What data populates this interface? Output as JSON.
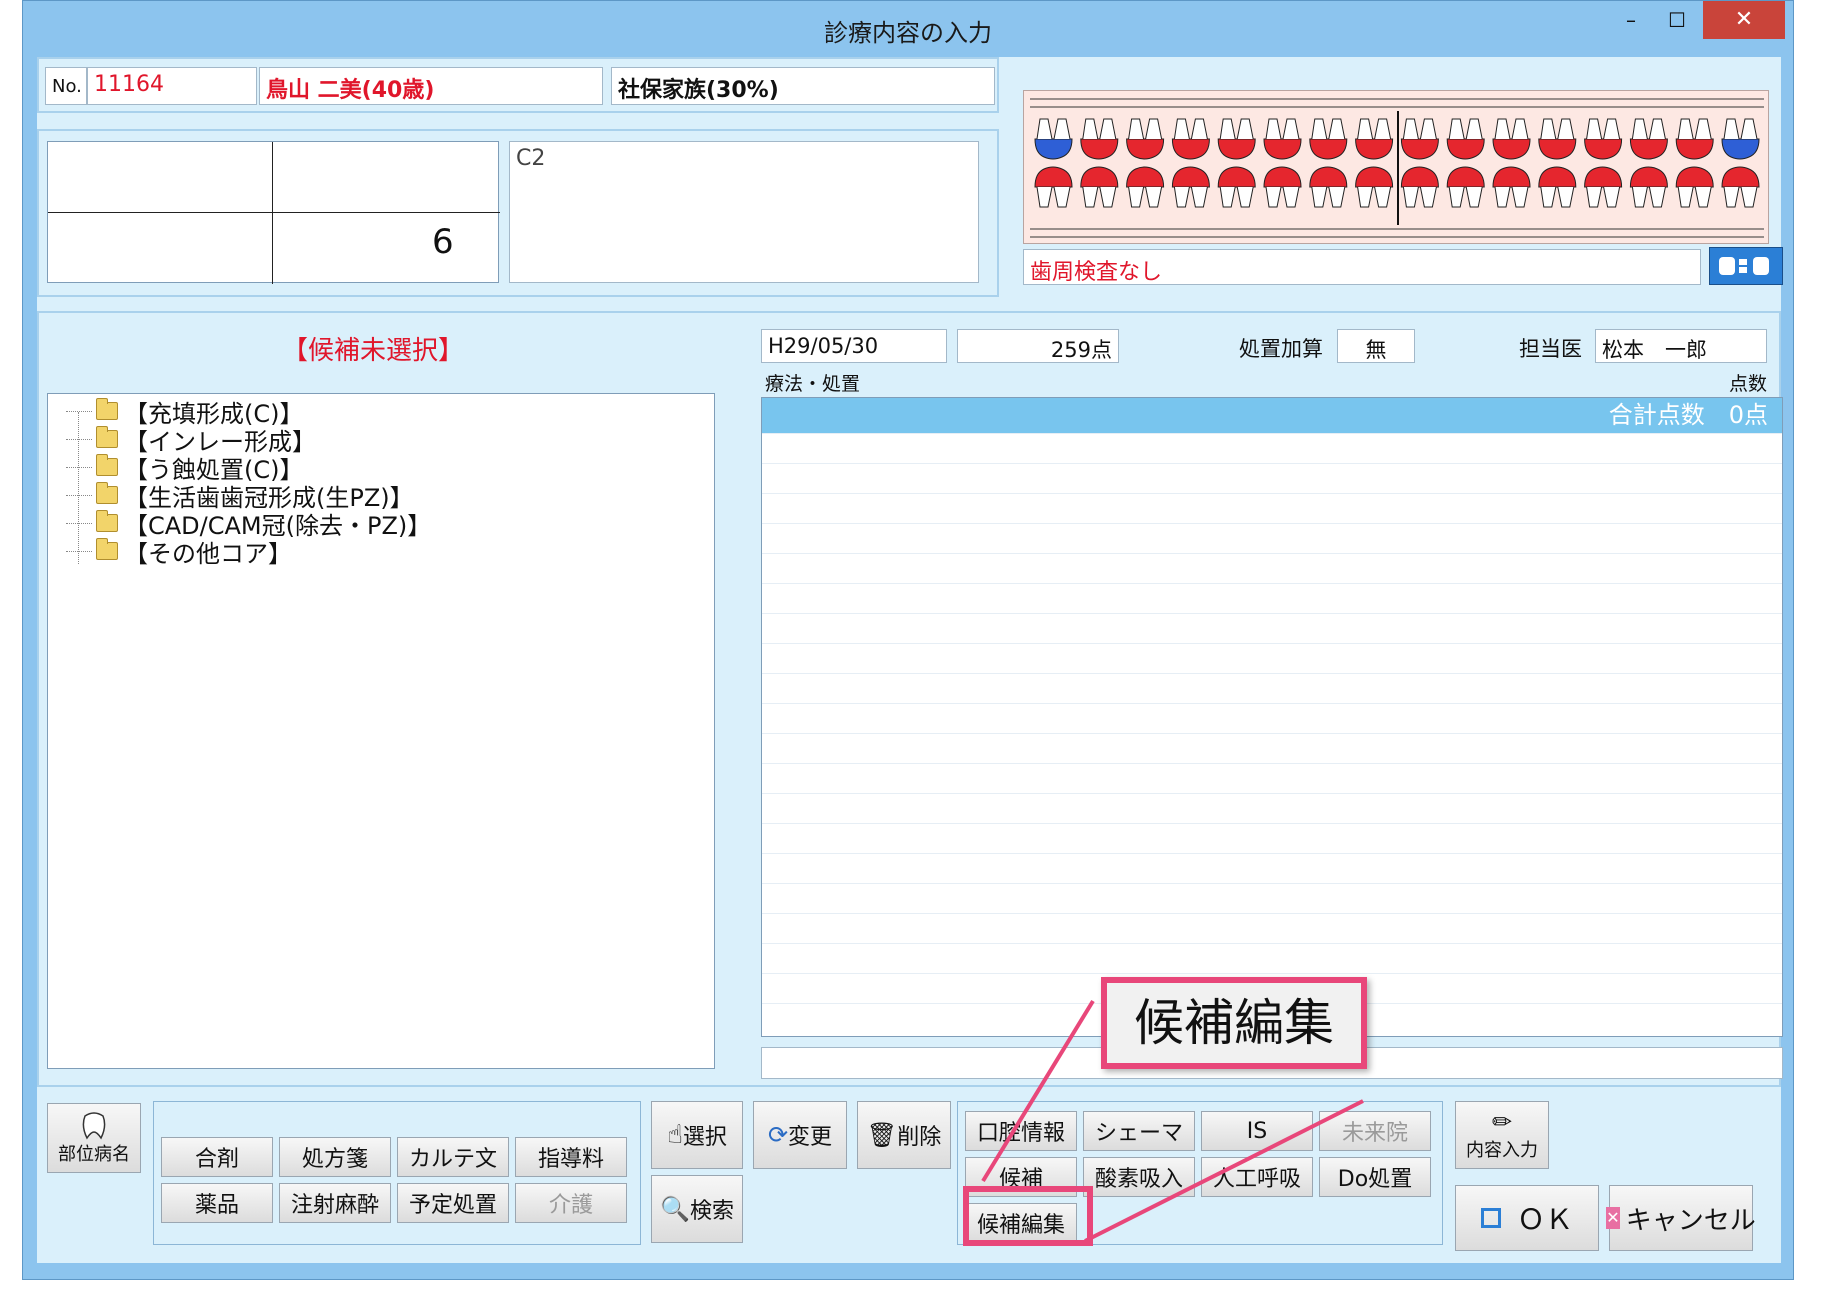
{
  "window": {
    "title": "診療内容の入力",
    "min_glyph": "–",
    "max_glyph": "☐",
    "close_glyph": "✕"
  },
  "patient": {
    "no_label": "No.",
    "number": "11164",
    "name": "鳥山 二美(40歳)",
    "insurance": "社保家族(30%)"
  },
  "tooth_position": {
    "lower_right": "6",
    "diagnosis": "C2"
  },
  "perio": {
    "text": "歯周検査なし"
  },
  "candidate": {
    "title": "【候補未選択】",
    "items": [
      "【充填形成(C)】",
      "【インレー形成】",
      "【う蝕処置(C)】",
      "【生活歯歯冠形成(生PZ)】",
      "【CAD/CAM冠(除去・PZ)】",
      "【その他コア】"
    ]
  },
  "record": {
    "date": "H29/05/30",
    "points": "259点",
    "addition_label": "処置加算",
    "addition_value": "無",
    "doctor_label": "担当医",
    "doctor_name": "松本　一郎",
    "col_treatment": "療法・処置",
    "col_points": "点数",
    "total": "合計点数　0点"
  },
  "buttons": {
    "region_disease": "部位病名",
    "left_grid": [
      "合剤",
      "処方箋",
      "カルテ文",
      "指導料",
      "薬品",
      "注射麻酔",
      "予定処置",
      "介護"
    ],
    "select": "選択",
    "change": "変更",
    "delete": "削除",
    "search": "検索",
    "right_grid": [
      "口腔情報",
      "シェーマ",
      "IS",
      "未来院",
      "候補",
      "酸素吸入",
      "人工呼吸",
      "Do処置"
    ],
    "candidate_edit": "候補編集",
    "content_input": "内容入力",
    "ok": "ＯＫ",
    "cancel": "キャンセル"
  },
  "callout": {
    "text": "候補編集"
  }
}
